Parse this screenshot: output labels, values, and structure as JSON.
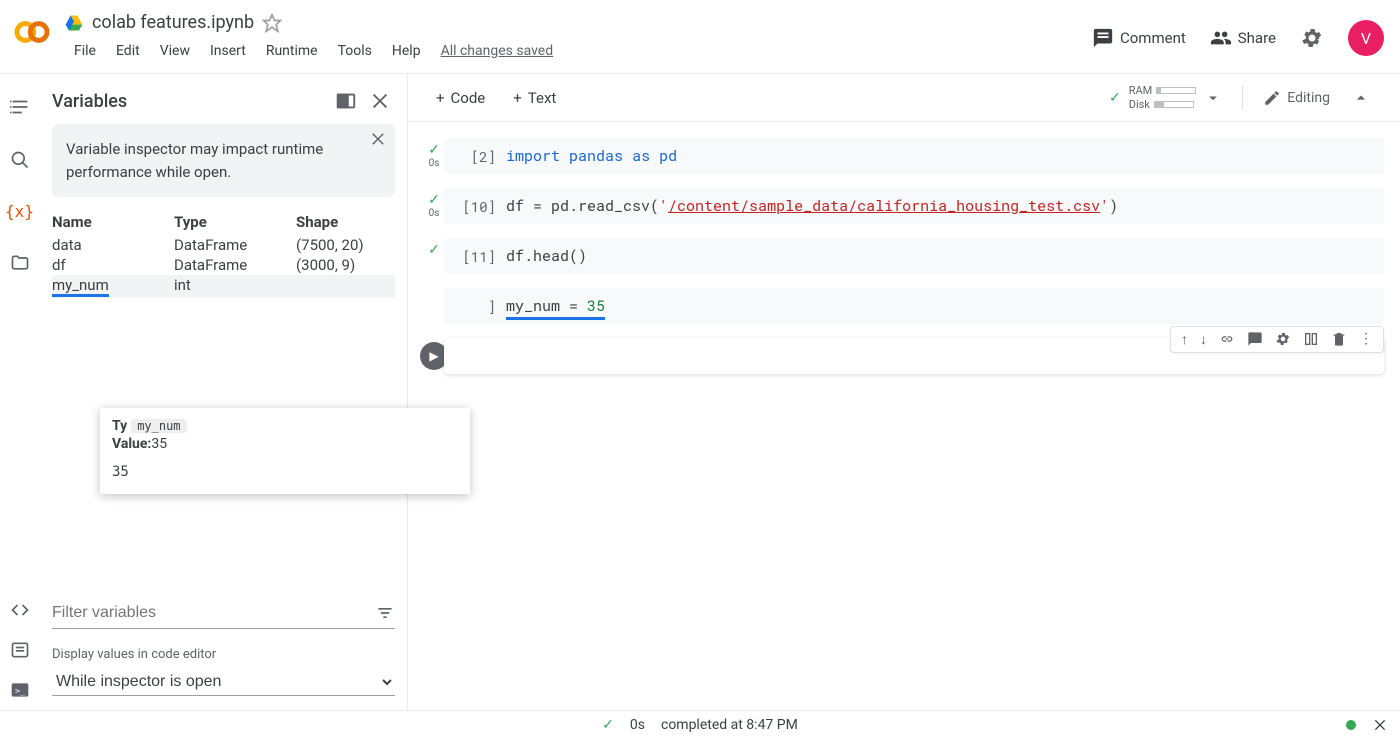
{
  "header": {
    "doc_title": "colab features.ipynb",
    "avatar_letter": "V",
    "comment_label": "Comment",
    "share_label": "Share",
    "menus": [
      "File",
      "Edit",
      "View",
      "Insert",
      "Runtime",
      "Tools",
      "Help"
    ],
    "status": "All changes saved"
  },
  "toolbar": {
    "code_label": "Code",
    "text_label": "Text",
    "editing_label": "Editing",
    "resources": {
      "ram_label": "RAM",
      "ram_pct": 10,
      "disk_label": "Disk",
      "disk_pct": 25
    }
  },
  "panel": {
    "title": "Variables",
    "warning": "Variable inspector may impact runtime performance while open.",
    "cols": {
      "name": "Name",
      "type": "Type",
      "shape": "Shape"
    },
    "rows": [
      {
        "name": "data",
        "type": "DataFrame",
        "shape": "(7500, 20)"
      },
      {
        "name": "df",
        "type": "DataFrame",
        "shape": "(3000, 9)"
      },
      {
        "name": "my_num",
        "type": "int",
        "shape": ""
      }
    ],
    "filter_placeholder": "Filter variables",
    "display_label": "Display values in code editor",
    "display_value": "While inspector is open"
  },
  "tooltip": {
    "name_chip": "my_num",
    "ty_label": "Ty",
    "value_label": "Value:",
    "value": "35",
    "body": "35"
  },
  "cells": [
    {
      "exec": "[2]",
      "time": "0s",
      "code_html": "<span class='kw'>import</span> <span class='kw2'>pandas</span> <span class='kw'>as</span> <span class='kw2'>pd</span>"
    },
    {
      "exec": "[10]",
      "time": "0s",
      "code_html": "df = pd.read_csv(<span class='str'>'</span><span class='str-link'>/content/sample_data/california_housing_test.csv</span><span class='str'>'</span>)"
    },
    {
      "exec": "[11]",
      "time": "",
      "code_html": "df.head()"
    },
    {
      "exec": "]",
      "time": "",
      "code_html": "<span class='code-underline'>my_num = <span class='num'>35</span></span>",
      "active_input": true
    },
    {
      "exec": "",
      "time": "",
      "code_html": "",
      "active_output": true
    }
  ],
  "statusbar": {
    "duration": "0s",
    "message": "completed at 8:47 PM"
  }
}
